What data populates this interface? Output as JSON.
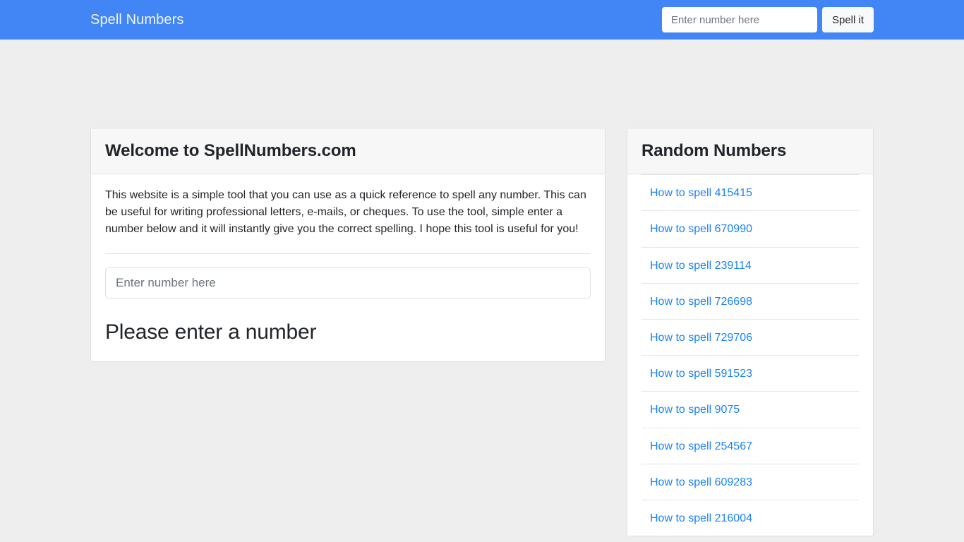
{
  "navbar": {
    "brand": "Spell Numbers",
    "search_placeholder": "Enter number here",
    "search_value": "",
    "button_label": "Spell it",
    "background_color": "#4285f4"
  },
  "main_card": {
    "title": "Welcome to SpellNumbers.com",
    "intro": "This website is a simple tool that you can use as a quick reference to spell any number. This can be useful for writing professional letters, e-mails, or cheques. To use the tool, simple enter a number below and it will instantly give you the correct spelling. I hope this tool is useful for you!",
    "input_placeholder": "Enter number here",
    "input_value": "",
    "result_heading": "Please enter a number"
  },
  "sidebar": {
    "title": "Random Numbers",
    "link_color": "#1a82f7",
    "items": [
      {
        "label": "How to spell 415415",
        "number": "415415"
      },
      {
        "label": "How to spell 670990",
        "number": "670990"
      },
      {
        "label": "How to spell 239114",
        "number": "239114"
      },
      {
        "label": "How to spell 726698",
        "number": "726698"
      },
      {
        "label": "How to spell 729706",
        "number": "729706"
      },
      {
        "label": "How to spell 591523",
        "number": "591523"
      },
      {
        "label": "How to spell 9075",
        "number": "9075"
      },
      {
        "label": "How to spell 254567",
        "number": "254567"
      },
      {
        "label": "How to spell 609283",
        "number": "609283"
      },
      {
        "label": "How to spell 216004",
        "number": "216004"
      }
    ]
  }
}
